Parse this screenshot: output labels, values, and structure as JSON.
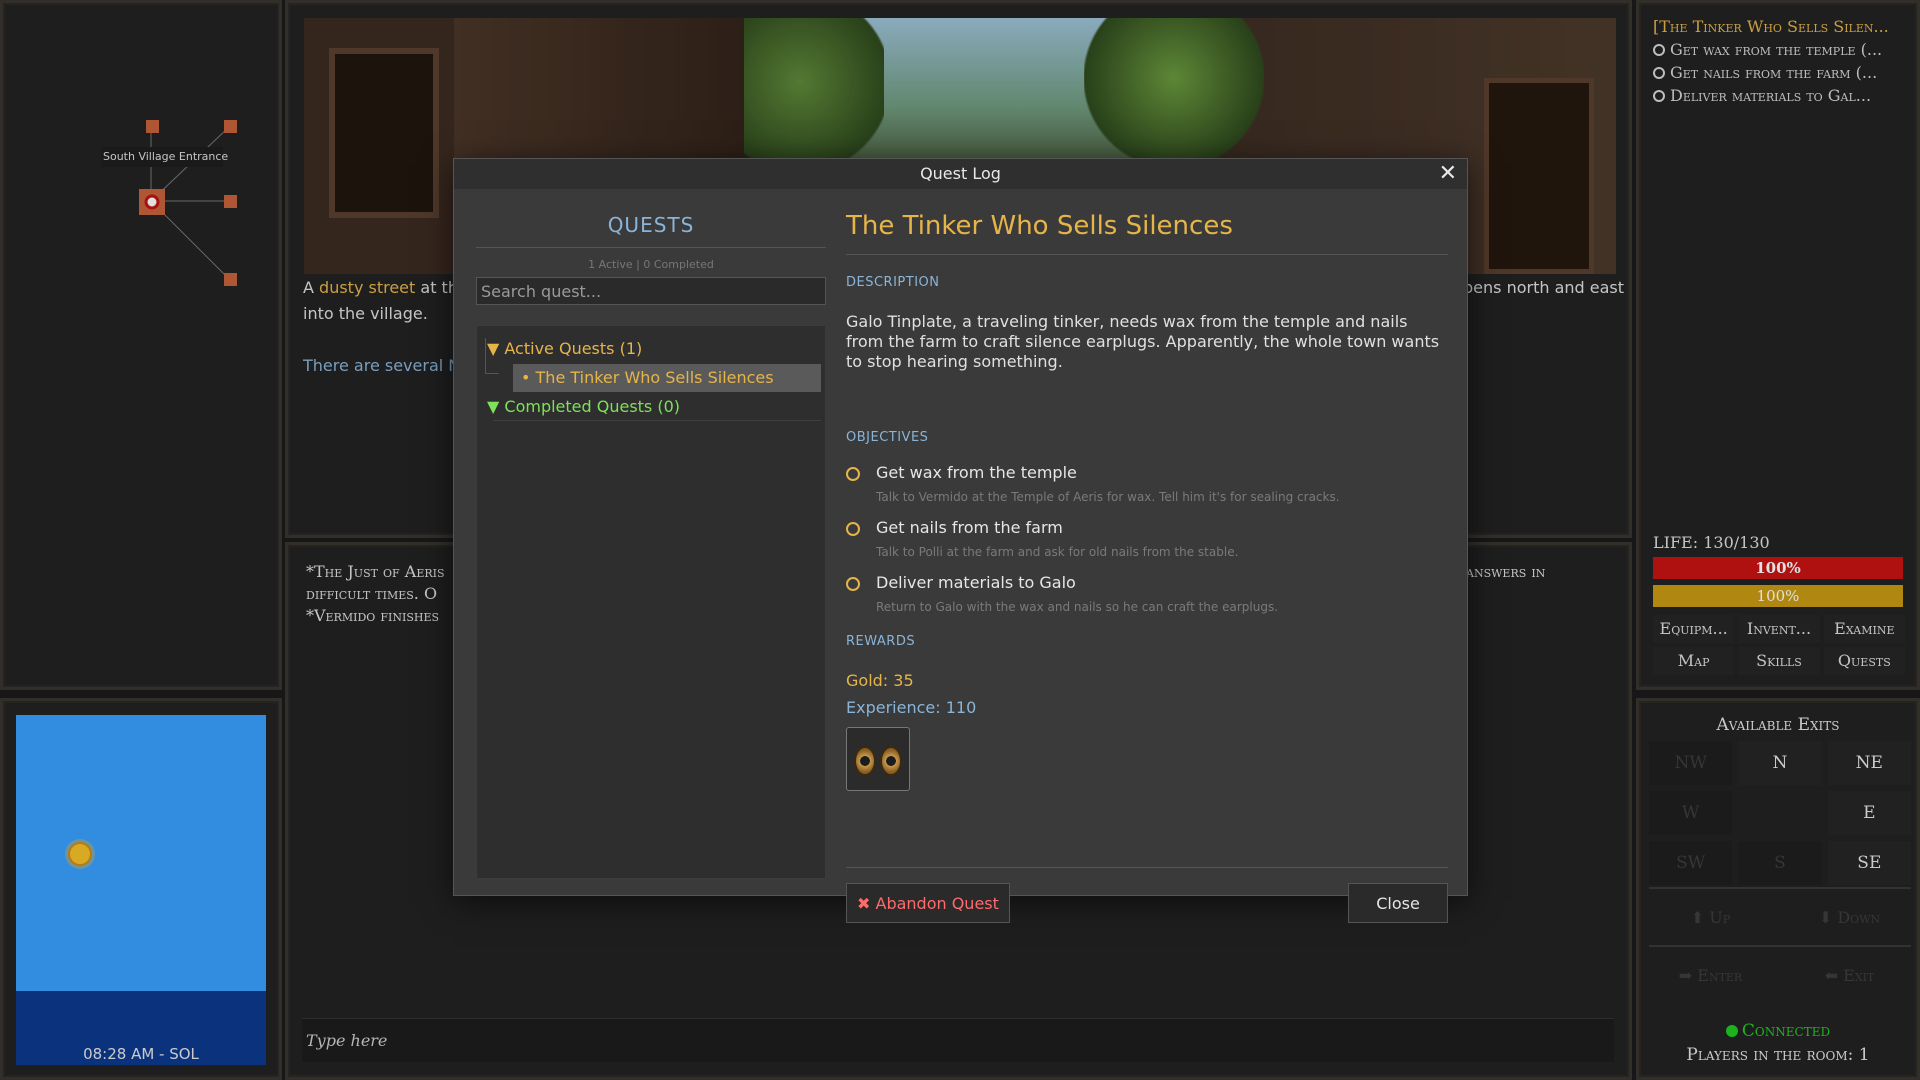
{
  "minimap": {
    "location_label": "South Village Entrance"
  },
  "clock": {
    "time": "08:28 AM - SOL"
  },
  "scene": {
    "desc_start": "A ",
    "desc_link": "dusty street",
    "desc_mid": " at the",
    "desc_line2": "into the village.",
    "desc_right": "pens north and east",
    "npcs_text": "There are several NP"
  },
  "chat": {
    "line1_left": "*The Just of Aeris",
    "line1_right": "answers in",
    "line2": "difficult times. O",
    "line3": "*Vermido finishes"
  },
  "input": {
    "placeholder": "Type here"
  },
  "tracker": {
    "title": "[The Tinker Who Sells Silen...",
    "items": [
      "Get wax from the temple (...",
      "Get nails from the farm (...",
      "Deliver materials to Gal..."
    ]
  },
  "stats": {
    "life_label": "LIFE: 130/130",
    "life_pct": "100%",
    "life_fraction": 1.0,
    "energy_pct": "100%",
    "energy_fraction": 1.0,
    "life_color": "#c81414",
    "energy_color": "#c89a14"
  },
  "actions": [
    "Equipm...",
    "Invent...",
    "Examine",
    "Map",
    "Skills",
    "Quests"
  ],
  "exits": {
    "title": "Available Exits",
    "grid": [
      "NW",
      "N",
      "NE",
      "W",
      "",
      "E",
      "SW",
      "S",
      "SE"
    ],
    "enabled": [
      false,
      true,
      true,
      false,
      false,
      true,
      false,
      false,
      true
    ],
    "up": "⬆ Up",
    "down": "⬇ Down",
    "enter": "➡ Enter",
    "exit": "⬅ Exit",
    "status": "Connected",
    "players": "Players in the room: 1"
  },
  "modal": {
    "title": "Quest Log",
    "close_x": "✕",
    "list_title": "QUESTS",
    "count": "1 Active | 0 Completed",
    "search_placeholder": "Search quest...",
    "active_group": "▼ Active Quests (1)",
    "active_items": [
      "• The Tinker Who Sells Silences"
    ],
    "completed_group": "▼ Completed Quests (0)",
    "quest_title": "The Tinker Who Sells Silences",
    "description_label": "DESCRIPTION",
    "description": "Galo Tinplate, a traveling tinker, needs wax from the temple and nails from the farm to craft silence earplugs. Apparently, the whole town wants to stop hearing something.",
    "objectives_label": "OBJECTIVES",
    "objectives": [
      {
        "title": "Get wax from the temple",
        "hint": "Talk to Vermido at the Temple of Aeris for wax. Tell him it's for sealing cracks."
      },
      {
        "title": "Get nails from the farm",
        "hint": "Talk to Polli at the farm and ask for old nails from the stable."
      },
      {
        "title": "Deliver materials to Galo",
        "hint": "Return to Galo with the wax and nails so he can craft the earplugs."
      }
    ],
    "rewards_label": "REWARDS",
    "gold": "Gold: 35",
    "experience": "Experience: 110",
    "abandon_label": "✖ Abandon Quest",
    "close_label": "Close"
  },
  "colors": {
    "accent_gold": "#e6b54a",
    "accent_blue": "#8ab4d8",
    "connected_green": "#22cc22",
    "danger_red": "#ff6a6a"
  }
}
